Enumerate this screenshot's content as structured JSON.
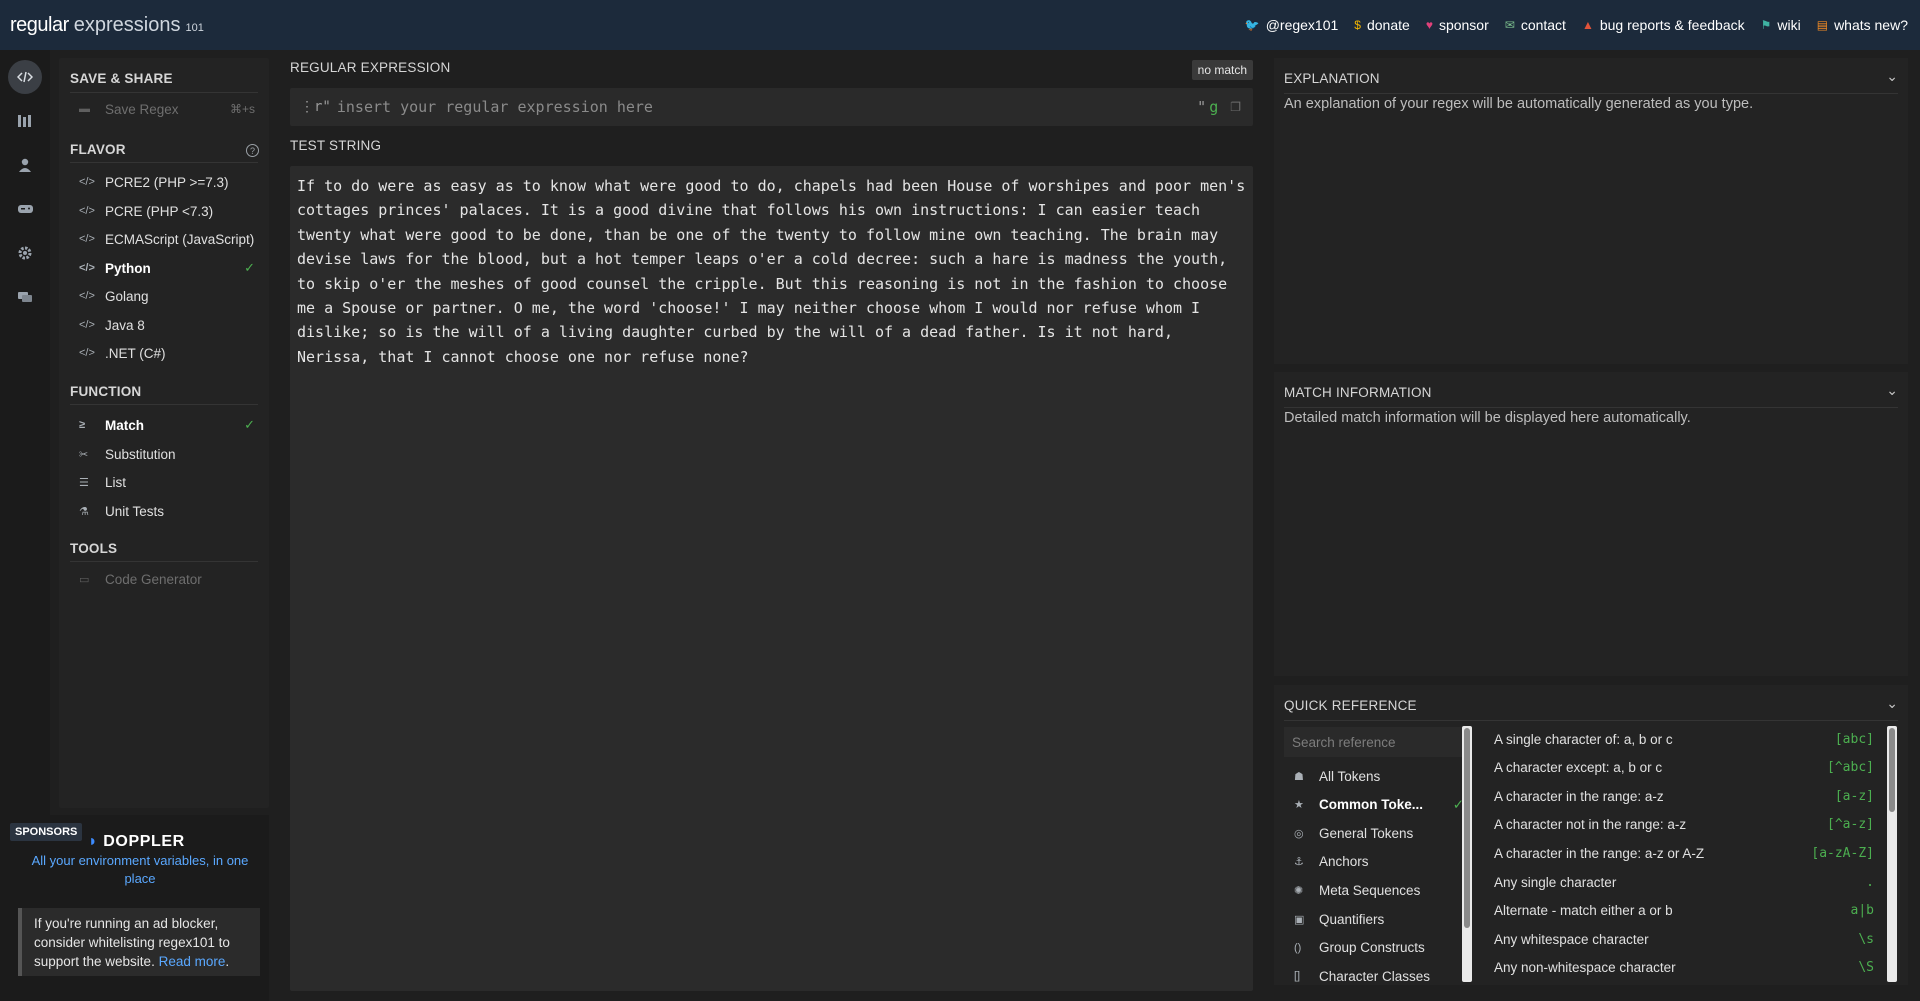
{
  "topbar": {
    "logo_main": "regular",
    "logo_sub": "expressions",
    "logo_ver": "101",
    "links": [
      {
        "label": "@regex101",
        "icon": "twitter-icon",
        "glyph": "🐦",
        "color": "#5aa8ff"
      },
      {
        "label": "donate",
        "icon": "dollar-icon",
        "glyph": "$",
        "color": "#f0b400"
      },
      {
        "label": "sponsor",
        "icon": "heart-icon",
        "glyph": "♥",
        "color": "#e0417a"
      },
      {
        "label": "contact",
        "icon": "envelope-icon",
        "glyph": "✉",
        "color": "#7cbf8e"
      },
      {
        "label": "bug reports & feedback",
        "icon": "warning-icon",
        "glyph": "▲",
        "color": "#e0533a"
      },
      {
        "label": "wiki",
        "icon": "flag-icon",
        "glyph": "⚑",
        "color": "#3fb3a3"
      },
      {
        "label": "whats new?",
        "icon": "document-icon",
        "glyph": "▤",
        "color": "#f08a24"
      }
    ]
  },
  "sidebar": {
    "save_share": {
      "heading": "SAVE & SHARE",
      "save_label": "Save Regex",
      "save_shortcut": "⌘+s"
    },
    "flavor": {
      "heading": "FLAVOR",
      "items": [
        {
          "label": "PCRE2 (PHP >=7.3)",
          "selected": false
        },
        {
          "label": "PCRE (PHP <7.3)",
          "selected": false
        },
        {
          "label": "ECMAScript (JavaScript)",
          "selected": false
        },
        {
          "label": "Python",
          "selected": true
        },
        {
          "label": "Golang",
          "selected": false
        },
        {
          "label": "Java 8",
          "selected": false
        },
        {
          "label": ".NET (C#)",
          "selected": false
        }
      ]
    },
    "function": {
      "heading": "FUNCTION",
      "items": [
        {
          "label": "Match",
          "icon": "terminal-icon",
          "glyph": "≥",
          "selected": true
        },
        {
          "label": "Substitution",
          "icon": "scissors-icon",
          "glyph": "✂",
          "selected": false
        },
        {
          "label": "List",
          "icon": "list-icon",
          "glyph": "☰",
          "selected": false
        },
        {
          "label": "Unit Tests",
          "icon": "flask-icon",
          "glyph": "⚗",
          "selected": false
        }
      ]
    },
    "tools": {
      "heading": "TOOLS",
      "code_generator": "Code Generator"
    }
  },
  "sponsors": {
    "badge": "SPONSORS",
    "brand": "DOPPLER",
    "tagline": "All your environment variables, in one place",
    "adblock_text": "If you're running an ad blocker, consider whitelisting regex101 to support the website.",
    "read_more": "Read more"
  },
  "editor": {
    "regex_label": "REGULAR EXPRESSION",
    "status": "no match",
    "delimiter": "r\"",
    "placeholder": "insert your regular expression here",
    "flags": "g",
    "flags_quote": "\"",
    "test_label": "TEST STRING",
    "test_string": "If to do were as easy as to know what were good to do, chapels had been House of worshipes and poor men's cottages princes' palaces. It is a good divine that follows his own instructions: I can easier teach twenty what were good to be done, than be one of the twenty to follow mine own teaching. The brain may devise laws for the blood, but a hot temper leaps o'er a cold decree: such a hare is madness the youth, to skip o'er the meshes of good counsel the cripple. But this reasoning is not in the fashion to choose me a Spouse or partner. O me, the word 'choose!' I may neither choose whom I would nor refuse whom I dislike; so is the will of a living daughter curbed by the will of a dead father. Is it not hard, Nerissa, that I cannot choose one nor refuse none?"
  },
  "explanation": {
    "heading": "EXPLANATION",
    "text": "An explanation of your regex will be automatically generated as you type."
  },
  "match_info": {
    "heading": "MATCH INFORMATION",
    "text": "Detailed match information will be displayed here automatically."
  },
  "quick_ref": {
    "heading": "QUICK REFERENCE",
    "search_placeholder": "Search reference",
    "categories": [
      {
        "label": "All Tokens",
        "icon": "stack-icon",
        "glyph": "☗",
        "selected": false
      },
      {
        "label": "Common Toke...",
        "icon": "star-icon",
        "glyph": "★",
        "selected": true
      },
      {
        "label": "General Tokens",
        "icon": "circle-dot-icon",
        "glyph": "◎",
        "selected": false
      },
      {
        "label": "Anchors",
        "icon": "anchor-icon",
        "glyph": "⚓",
        "selected": false
      },
      {
        "label": "Meta Sequences",
        "icon": "cog-icon",
        "glyph": "✺",
        "selected": false
      },
      {
        "label": "Quantifiers",
        "icon": "book-icon",
        "glyph": "▣",
        "selected": false
      },
      {
        "label": "Group Constructs",
        "icon": "parens-icon",
        "glyph": "()",
        "selected": false
      },
      {
        "label": "Character Classes",
        "icon": "brackets-icon",
        "glyph": "[]",
        "selected": false
      }
    ],
    "entries": [
      {
        "desc": "A single character of: a, b or c",
        "token": "[abc]"
      },
      {
        "desc": "A character except: a, b or c",
        "token": "[^abc]"
      },
      {
        "desc": "A character in the range: a-z",
        "token": "[a-z]"
      },
      {
        "desc": "A character not in the range: a-z",
        "token": "[^a-z]"
      },
      {
        "desc": "A character in the range: a-z or A-Z",
        "token": "[a-zA-Z]"
      },
      {
        "desc": "Any single character",
        "token": "."
      },
      {
        "desc": "Alternate - match either a or b",
        "token": "a|b"
      },
      {
        "desc": "Any whitespace character",
        "token": "\\s"
      },
      {
        "desc": "Any non-whitespace character",
        "token": "\\S"
      }
    ]
  }
}
